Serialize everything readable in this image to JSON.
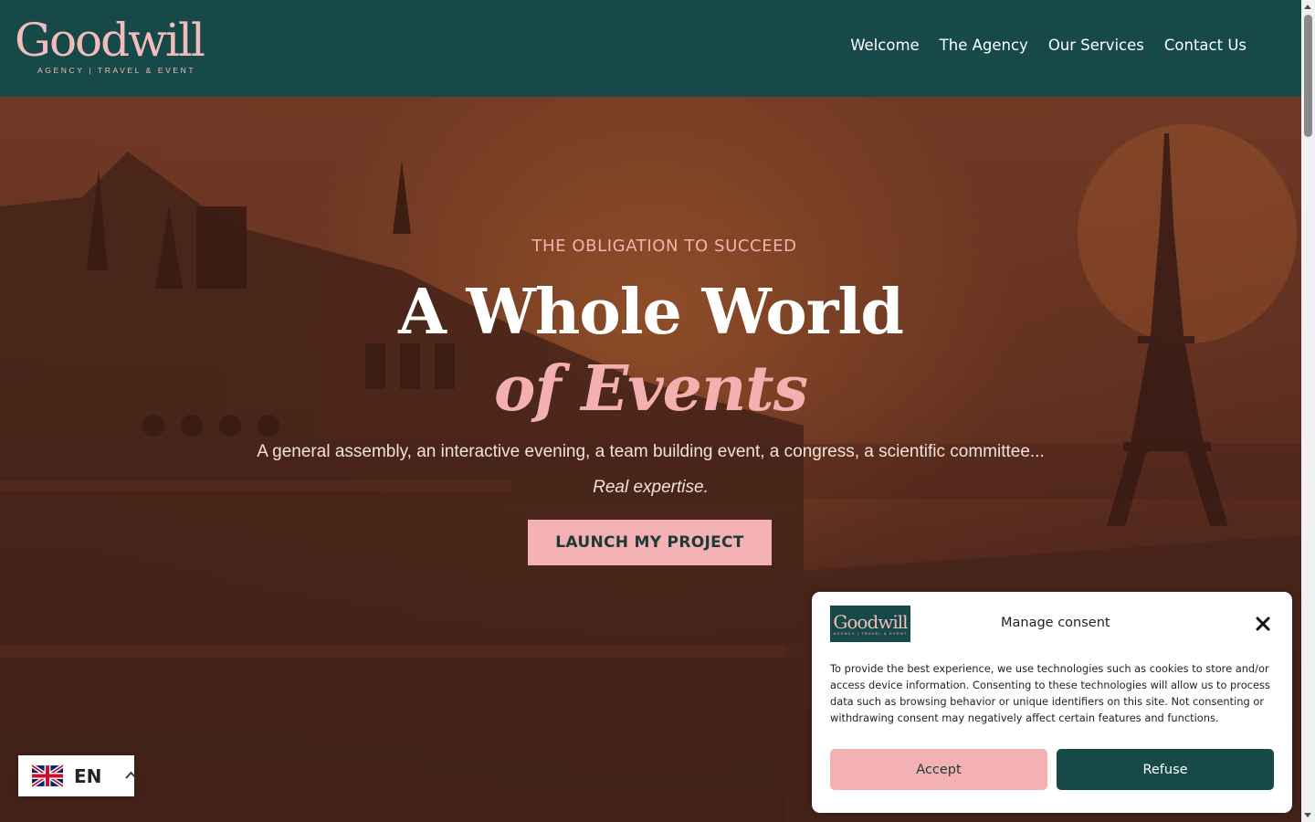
{
  "colors": {
    "header_bg": "#164947",
    "accent_pink": "#f3b1b3",
    "white": "#ffffff"
  },
  "brand": {
    "logo_word": "Goodwill",
    "logo_tagline": "AGENCY | TRAVEL & EVENT"
  },
  "nav": {
    "items": [
      {
        "label": "Welcome"
      },
      {
        "label": "The Agency"
      },
      {
        "label": "Our Services"
      },
      {
        "label": "Contact Us"
      }
    ]
  },
  "hero": {
    "eyebrow": "THE OBLIGATION TO SUCCEED",
    "headline_line1": "A Whole World",
    "headline_line2": "of Events",
    "subline": "A general assembly, an interactive evening, a team building event, a congress, a scientific committee...",
    "subline2": "Real expertise.",
    "cta_label": "LAUNCH MY PROJECT",
    "background_icon": "paris-opera-eiffel-tower-image"
  },
  "language": {
    "code": "EN",
    "flag_icon": "uk-flag-icon",
    "chevron_icon": "chevron-up-icon"
  },
  "consent": {
    "title": "Manage consent",
    "text": "To provide the best experience, we use technologies such as cookies to store and/or access device information. Consenting to these technologies will allow us to process data such as browsing behavior or unique identifiers on this site. Not consenting or withdrawing consent may negatively affect certain features and functions.",
    "accept_label": "Accept",
    "refuse_label": "Refuse",
    "close_icon": "close-icon"
  }
}
